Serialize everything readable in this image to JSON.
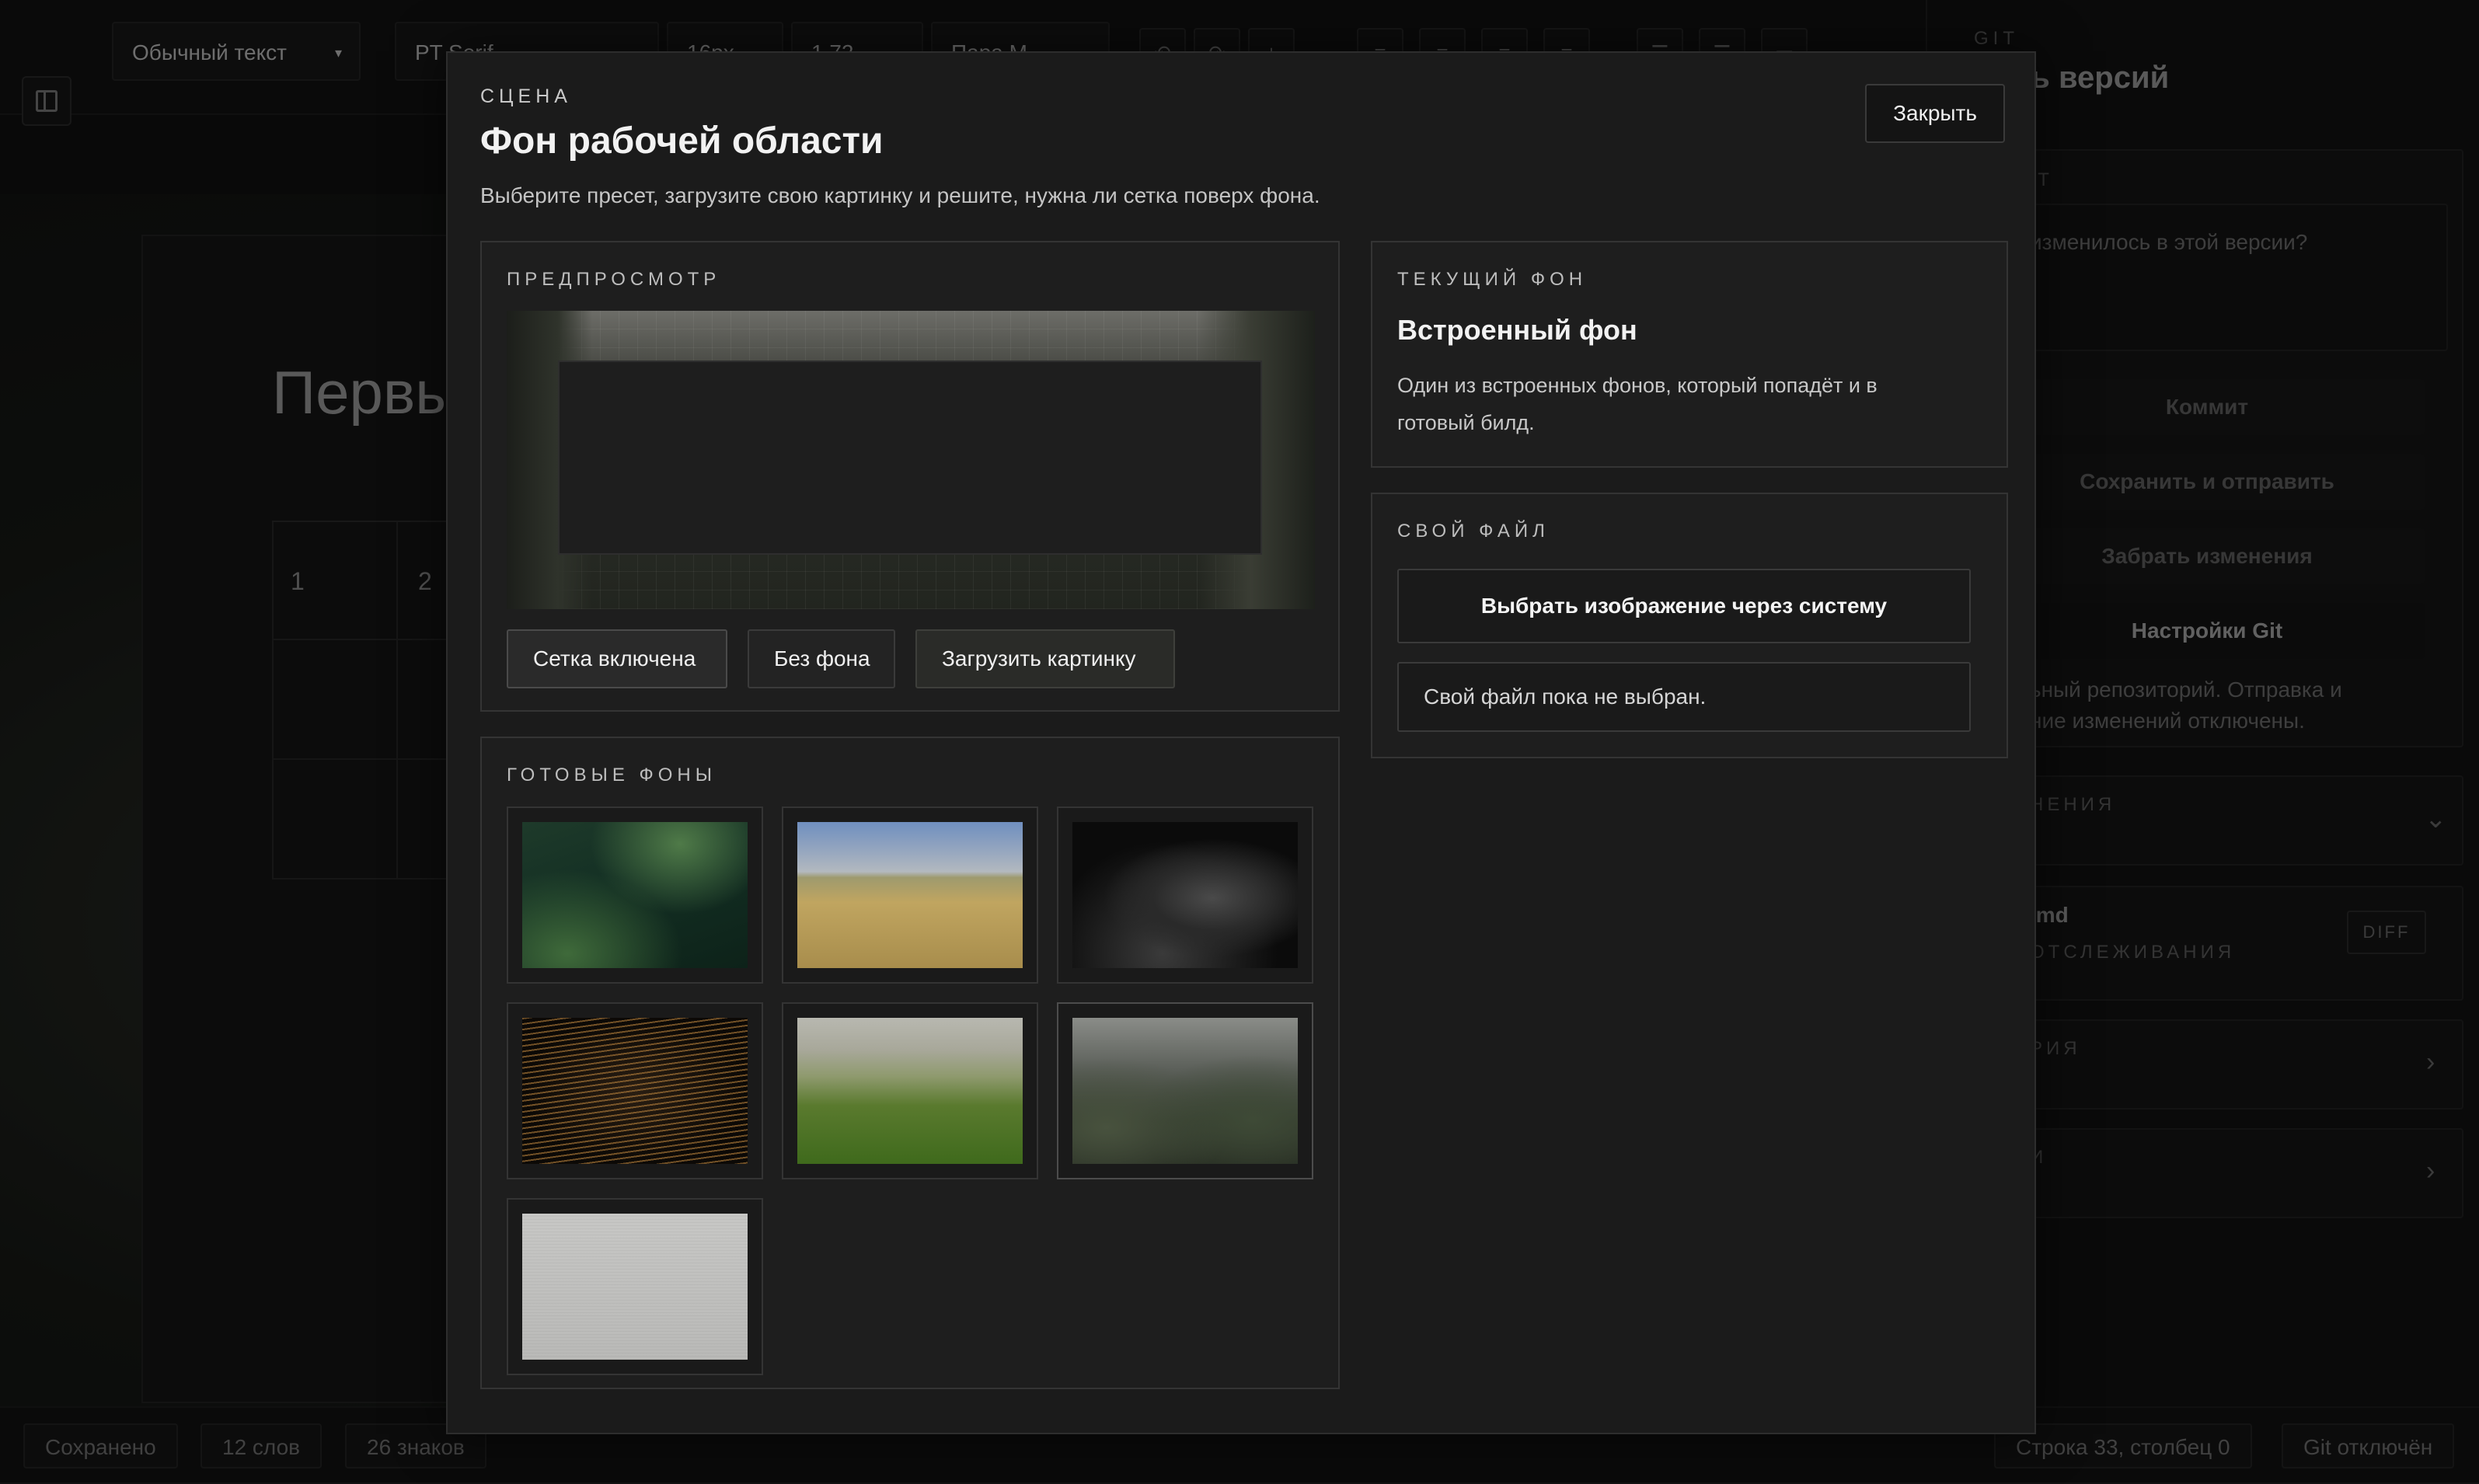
{
  "toolbar": {
    "paragraph_style": "Обычный текст",
    "font_family": "PT Serif",
    "font_size": "16px",
    "line_height": "1.72",
    "font_variant": "Пара М"
  },
  "document": {
    "title": "Первы",
    "table_cells": [
      "1",
      "2"
    ]
  },
  "git": {
    "section_label": "GIT",
    "title": "роль версий",
    "commit_label": "ИТ",
    "commit_placeholder": "изменилось в этой версии?",
    "commit_button": "Коммит",
    "save_push_button": "Сохранить и отправить",
    "pull_button": "Забрать изменения",
    "settings_button": "Настройки Git",
    "repo_note_1": "ьный репозиторий. Отправка и",
    "repo_note_2": "ние изменений отключены.",
    "changes_label": "НЕНИЯ",
    "file_name": ".md",
    "file_status": "ОТСЛЕЖИВАНИЯ",
    "diff_button": "DIFF",
    "history_label": "РИЯ",
    "extra_label": "И"
  },
  "statusbar": {
    "saved": "Сохранено",
    "words": "12 слов",
    "chars": "26 знаков",
    "position": "Строка 33, столбец 0",
    "git_state": "Git отключён"
  },
  "modal": {
    "eyebrow": "СЦЕНА",
    "title": "Фон рабочей области",
    "subtitle": "Выберите пресет, загрузите свою картинку и решите, нужна ли сетка поверх фона.",
    "close_label": "Закрыть",
    "preview": {
      "label": "ПРЕДПРОСМОТР",
      "grid_button": "Сетка включена",
      "no_bg_button": "Без фона",
      "upload_button": "Загрузить картинку"
    },
    "presets": {
      "label": "ГОТОВЫЕ ФОНЫ",
      "items": [
        "jungle-leaves",
        "wheat-field",
        "dark-abstract-shape",
        "golden-wave-lines",
        "green-meadow",
        "misty-cliffs",
        "linen-texture"
      ],
      "selected": "misty-cliffs"
    },
    "current": {
      "label": "ТЕКУЩИЙ ФОН",
      "title": "Встроенный фон",
      "description": "Один из встроенных фонов, который попадёт и в готовый билд."
    },
    "custom": {
      "label": "СВОЙ ФАЙЛ",
      "choose_button": "Выбрать изображение через систему",
      "status": "Свой файл пока не выбран."
    }
  }
}
